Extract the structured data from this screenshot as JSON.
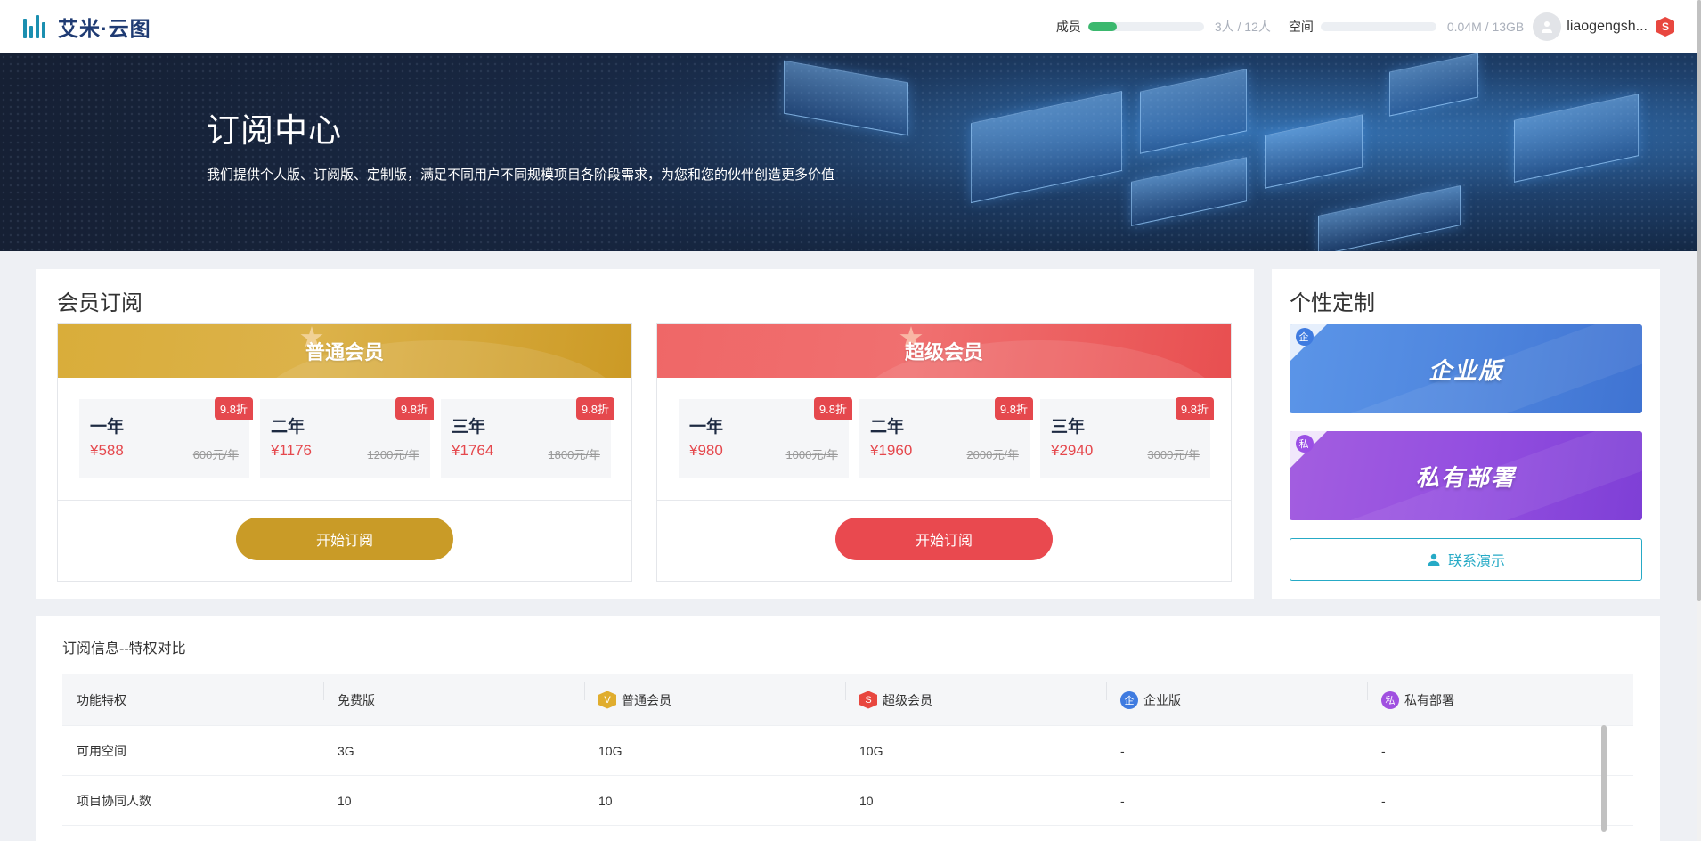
{
  "header": {
    "logo_text": "艾米·云图",
    "members_label": "成员",
    "members_fraction": 0.25,
    "members_value": "3人 / 12人",
    "space_label": "空间",
    "space_fraction": 0.0,
    "space_value": "0.04M / 13GB",
    "username": "liaogengsh...",
    "badge": "S"
  },
  "hero": {
    "title": "订阅中心",
    "subtitle": "我们提供个人版、订阅版、定制版，满足不同用户不同规模项目各阶段需求，为您和您的伙伴创造更多价值"
  },
  "membership": {
    "title": "会员订阅",
    "tiers": [
      {
        "name": "普通会员",
        "button": "开始订阅",
        "plans": [
          {
            "period": "一年",
            "price": "¥588",
            "old": "600元/年",
            "discount": "9.8折"
          },
          {
            "period": "二年",
            "price": "¥1176",
            "old": "1200元/年",
            "discount": "9.8折"
          },
          {
            "period": "三年",
            "price": "¥1764",
            "old": "1800元/年",
            "discount": "9.8折"
          }
        ]
      },
      {
        "name": "超级会员",
        "button": "开始订阅",
        "plans": [
          {
            "period": "一年",
            "price": "¥980",
            "old": "1000元/年",
            "discount": "9.8折"
          },
          {
            "period": "二年",
            "price": "¥1960",
            "old": "2000元/年",
            "discount": "9.8折"
          },
          {
            "period": "三年",
            "price": "¥2940",
            "old": "3000元/年",
            "discount": "9.8折"
          }
        ]
      }
    ]
  },
  "custom": {
    "title": "个性定制",
    "enterprise": {
      "badge": "企",
      "label": "企业版"
    },
    "private": {
      "badge": "私",
      "label": "私有部署"
    },
    "demo_button": "联系演示"
  },
  "comparison": {
    "title": "订阅信息--特权对比",
    "columns": [
      "功能特权",
      "免费版",
      "普通会员",
      "超级会员",
      "企业版",
      "私有部署"
    ],
    "column_badges": [
      "",
      "",
      "V",
      "S",
      "企",
      "私"
    ],
    "rows": [
      [
        "可用空间",
        "3G",
        "10G",
        "10G",
        "-",
        "-"
      ],
      [
        "项目协同人数",
        "10",
        "10",
        "10",
        "-",
        "-"
      ]
    ]
  },
  "colors": {
    "gold": "#c99b27",
    "red": "#e9494f",
    "teal": "#26aac6",
    "enterprise_blue": "#4f86de",
    "private_purple": "#944fe0"
  }
}
